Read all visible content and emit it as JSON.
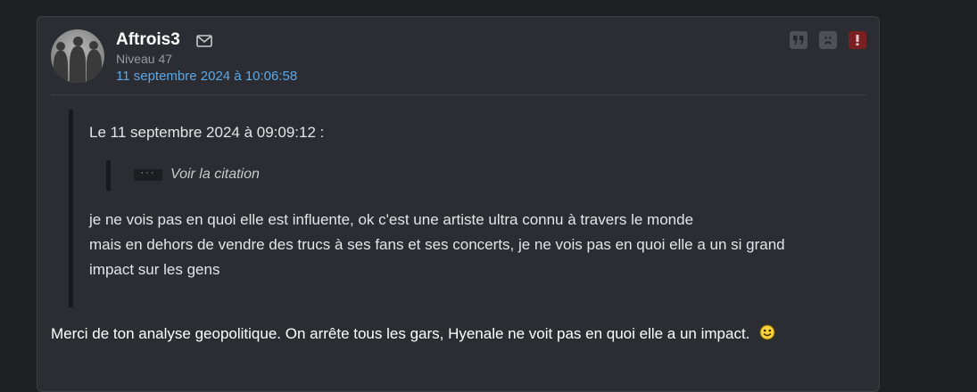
{
  "post": {
    "author": {
      "username": "Aftrois3",
      "level": "Niveau 47",
      "avatar_icon": "avatar-image",
      "mail_icon": "envelope-icon"
    },
    "date": "11 septembre 2024 à 10:06:58",
    "actions": [
      {
        "icon": "quote-icon"
      },
      {
        "icon": "sad-face-icon"
      },
      {
        "icon": "alert-icon"
      }
    ],
    "quote": {
      "header": "Le 11 septembre 2024 à 09:09:12 :",
      "nested_ellipsis": "···",
      "nested_label": "Voir la citation",
      "body_lines": [
        "je ne vois pas en quoi elle est influente, ok c'est une artiste ultra connu à travers le monde",
        "mais en dehors de vendre des trucs à ses fans et ses concerts, je ne vois pas en quoi elle a un si grand",
        "impact sur les gens"
      ]
    },
    "message": "Merci de ton analyse geopolitique. On arrête tous les gars, Hyenale ne voit pas en quoi elle a un impact.",
    "smiley_icon": "smiley-icon"
  },
  "colors": {
    "background": "#1f2024",
    "card": "#2c2d32",
    "date_link": "#5aa8e8",
    "alert": "#7a1f22"
  }
}
